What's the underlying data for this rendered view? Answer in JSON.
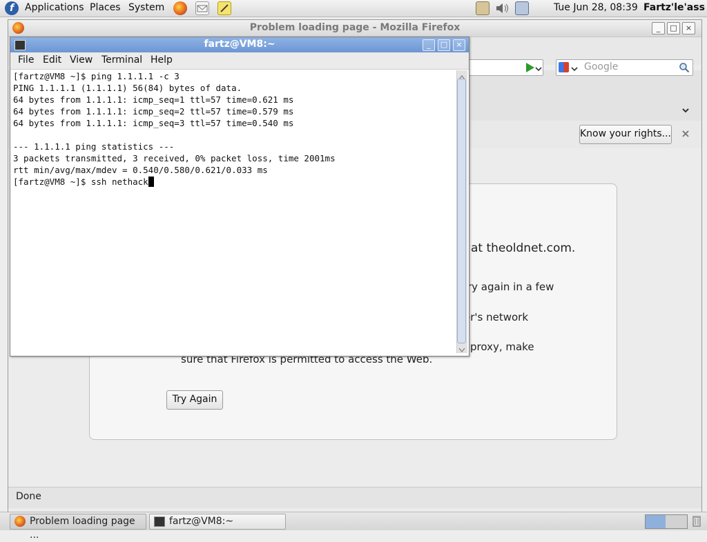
{
  "top_panel": {
    "menus": [
      "Applications",
      "Places",
      "System"
    ],
    "clock": "Tue Jun 28, 08:39",
    "user": "Fartz'le'ass"
  },
  "firefox": {
    "title": "Problem loading page - Mozilla Firefox",
    "search_placeholder": "Google",
    "notification_button": "Know your rights...",
    "error_lines": [
      "at theoldnet.com.",
      "ry again in a few",
      "er's network",
      "proxy, make",
      "sure that Firefox is permitted to access the Web."
    ],
    "try_again_label": "Try Again",
    "status": "Done"
  },
  "terminal": {
    "title": "fartz@VM8:~",
    "menu": [
      "File",
      "Edit",
      "View",
      "Terminal",
      "Help"
    ],
    "lines": [
      "[fartz@VM8 ~]$ ping 1.1.1.1 -c 3",
      "PING 1.1.1.1 (1.1.1.1) 56(84) bytes of data.",
      "64 bytes from 1.1.1.1: icmp_seq=1 ttl=57 time=0.621 ms",
      "64 bytes from 1.1.1.1: icmp_seq=2 ttl=57 time=0.579 ms",
      "64 bytes from 1.1.1.1: icmp_seq=3 ttl=57 time=0.540 ms",
      "",
      "--- 1.1.1.1 ping statistics ---",
      "3 packets transmitted, 3 received, 0% packet loss, time 2001ms",
      "rtt min/avg/max/mdev = 0.540/0.580/0.621/0.033 ms",
      "[fartz@VM8 ~]$ ssh nethack"
    ]
  },
  "taskbar": {
    "items": [
      "Problem loading page ...",
      "fartz@VM8:~"
    ]
  },
  "colors": {
    "terminal_titlebar": "#7aa0d9",
    "fedora_blue": "#2b5fa8",
    "go_green": "#2c9b2c"
  },
  "icons": [
    "fedora-logo-icon",
    "firefox-icon",
    "mail-icon",
    "notes-icon",
    "network-icon",
    "volume-icon",
    "display-icon",
    "trash-icon"
  ]
}
